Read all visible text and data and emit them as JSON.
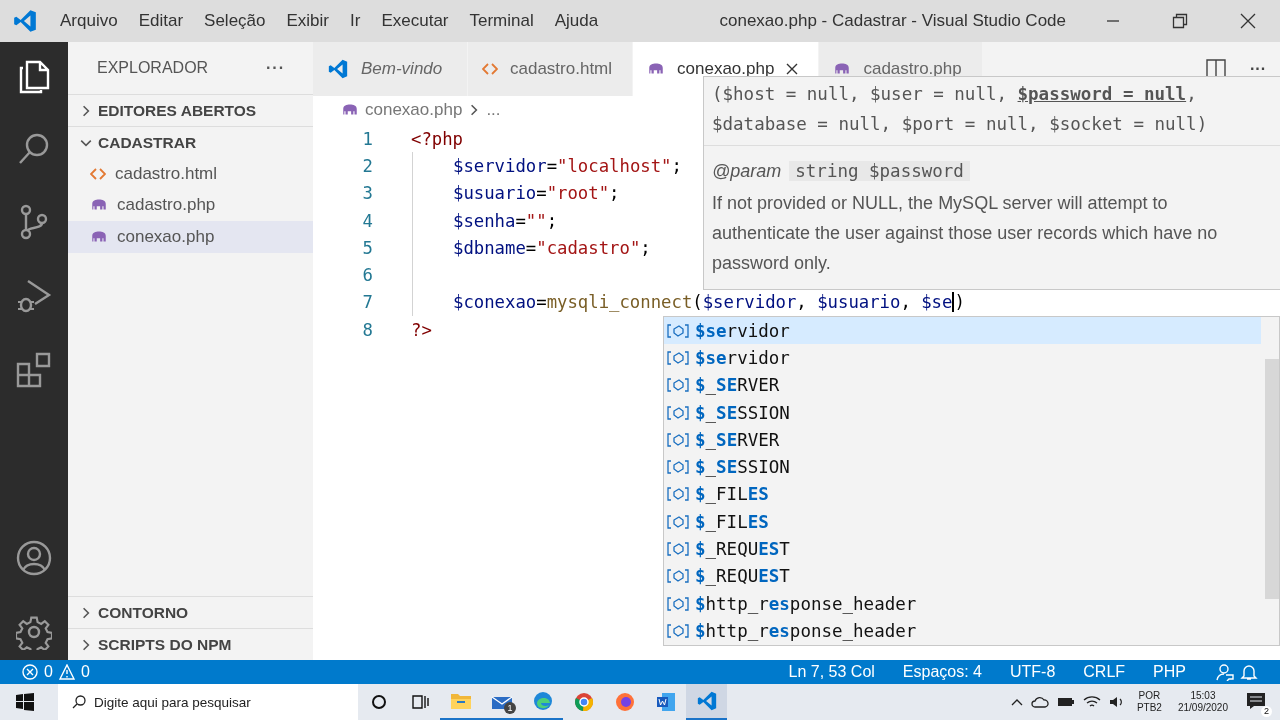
{
  "window": {
    "title": "conexao.php - Cadastrar - Visual Studio Code"
  },
  "menu": [
    "Arquivo",
    "Editar",
    "Seleção",
    "Exibir",
    "Ir",
    "Executar",
    "Terminal",
    "Ajuda"
  ],
  "activity_bar": [
    {
      "kind": "files",
      "selected": true
    },
    {
      "kind": "search",
      "selected": false
    },
    {
      "kind": "source-control",
      "selected": false
    },
    {
      "kind": "run",
      "selected": false
    },
    {
      "kind": "extensions",
      "selected": false
    },
    {
      "kind": "account",
      "selected": false
    },
    {
      "kind": "settings",
      "selected": false
    }
  ],
  "sidebar": {
    "title": "EXPLORADOR",
    "more": "···",
    "top_sections": [
      {
        "label": "EDITORES ABERTOS",
        "expanded": false
      },
      {
        "label": "CADASTRAR",
        "expanded": true,
        "files": [
          {
            "name": "cadastro.html",
            "kind": "html",
            "selected": false
          },
          {
            "name": "cadastro.php",
            "kind": "php",
            "selected": false
          },
          {
            "name": "conexao.php",
            "kind": "php",
            "selected": true
          }
        ]
      }
    ],
    "bottom_sections": [
      {
        "label": "CONTORNO",
        "expanded": false
      },
      {
        "label": "SCRIPTS DO NPM",
        "expanded": false
      }
    ]
  },
  "tabs": [
    {
      "label": "Bem-vindo",
      "kind": "vscode",
      "preview": true,
      "selected": false,
      "close": false
    },
    {
      "label": "cadastro.html",
      "kind": "html",
      "preview": false,
      "selected": false,
      "close": false
    },
    {
      "label": "conexao.php",
      "kind": "php",
      "preview": false,
      "selected": true,
      "close": true
    },
    {
      "label": "cadastro.php",
      "kind": "php",
      "preview": false,
      "selected": false,
      "close": false
    }
  ],
  "breadcrumb": {
    "file": "conexao.php",
    "rest": "..."
  },
  "code": [
    {
      "number": "1",
      "indented": false,
      "tokens": [
        {
          "text": "<?php",
          "kind": "tag"
        }
      ]
    },
    {
      "number": "2",
      "indented": true,
      "tokens": [
        {
          "text": "$servidor",
          "kind": "variable"
        },
        {
          "text": "=",
          "kind": "plain"
        },
        {
          "text": "\"localhost\"",
          "kind": "string"
        },
        {
          "text": ";",
          "kind": "plain"
        }
      ]
    },
    {
      "number": "3",
      "indented": true,
      "tokens": [
        {
          "text": "$usuario",
          "kind": "variable"
        },
        {
          "text": "=",
          "kind": "plain"
        },
        {
          "text": "\"root\"",
          "kind": "string"
        },
        {
          "text": ";",
          "kind": "plain"
        }
      ]
    },
    {
      "number": "4",
      "indented": true,
      "tokens": [
        {
          "text": "$senha",
          "kind": "variable"
        },
        {
          "text": "=",
          "kind": "plain"
        },
        {
          "text": "\"\"",
          "kind": "string"
        },
        {
          "text": ";",
          "kind": "plain"
        }
      ]
    },
    {
      "number": "5",
      "indented": true,
      "tokens": [
        {
          "text": "$dbname",
          "kind": "variable"
        },
        {
          "text": "=",
          "kind": "plain"
        },
        {
          "text": "\"cadastro\"",
          "kind": "string"
        },
        {
          "text": ";",
          "kind": "plain"
        }
      ]
    },
    {
      "number": "6",
      "indented": true
    },
    {
      "number": "7",
      "indented": true,
      "tokens": [
        {
          "text": "$conexao",
          "kind": "variable"
        },
        {
          "text": "=",
          "kind": "plain"
        },
        {
          "text": "mysqli_connect",
          "kind": "function"
        },
        {
          "text": "(",
          "kind": "plain"
        },
        {
          "text": "$servidor",
          "kind": "variable"
        },
        {
          "text": ", ",
          "kind": "plain"
        },
        {
          "text": "$usuario",
          "kind": "variable"
        },
        {
          "text": ", ",
          "kind": "plain"
        },
        {
          "text": "$se",
          "kind": "variable",
          "cursor_after": true
        },
        {
          "text": ")",
          "kind": "plain"
        }
      ]
    },
    {
      "number": "8",
      "indented": false,
      "tokens": [
        {
          "text": "?>",
          "kind": "tag"
        }
      ]
    }
  ],
  "hover": {
    "signature": "($host = null, $user = null, **$password = null**, $database = null, $port = null, $socket = null)",
    "param_tag": "@param",
    "param": "string $password",
    "description": "If not provided or NULL, the MySQL server will attempt to authenticate the user against those user records which have no password only."
  },
  "suggestions": [
    {
      "selected": true,
      "label": "**$se**rvidor"
    },
    {
      "selected": false,
      "label": "**$se**rvidor"
    },
    {
      "selected": false,
      "label": "**$**_**SE**RVER"
    },
    {
      "selected": false,
      "label": "**$**_**SE**SSION"
    },
    {
      "selected": false,
      "label": "**$**_**SE**RVER"
    },
    {
      "selected": false,
      "label": "**$**_**SE**SSION"
    },
    {
      "selected": false,
      "label": "**$**_FIL**ES**"
    },
    {
      "selected": false,
      "label": "**$**_FIL**ES**"
    },
    {
      "selected": false,
      "label": "**$**_REQU**ES**T"
    },
    {
      "selected": false,
      "label": "**$**_REQU**ES**T"
    },
    {
      "selected": false,
      "label": "**$**http_r**es**ponse_header"
    },
    {
      "selected": false,
      "label": "**$**http_r**es**ponse_header"
    }
  ],
  "status_bar": {
    "errors": "0",
    "warnings": "0",
    "items": [
      "Ln 7, 53 Col",
      "Espaços: 4",
      "UTF-8",
      "CRLF",
      "PHP"
    ]
  },
  "taskbar": {
    "search_placeholder": "Digite aqui para pesquisar",
    "apps": [
      {
        "kind": "cortana",
        "running": false,
        "selected": false
      },
      {
        "kind": "task-view",
        "running": false,
        "selected": false
      },
      {
        "kind": "folder",
        "running": true,
        "selected": false
      },
      {
        "kind": "mail",
        "running": true,
        "selected": false,
        "badge": "1"
      },
      {
        "kind": "edge",
        "running": true,
        "selected": false
      },
      {
        "kind": "chrome",
        "running": false,
        "selected": false
      },
      {
        "kind": "firefox",
        "running": false,
        "selected": false
      },
      {
        "kind": "word",
        "running": false,
        "selected": false
      },
      {
        "kind": "vscode",
        "running": true,
        "selected": true
      }
    ],
    "language": "POR",
    "layout": "PTB2",
    "time": "15:03",
    "date": "21/09/2020",
    "notifications": "2"
  }
}
